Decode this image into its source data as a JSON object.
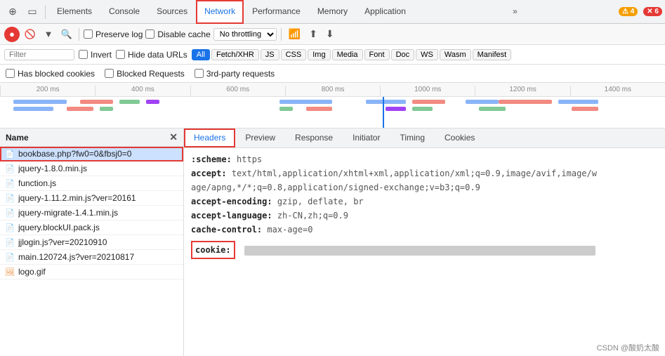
{
  "devtools": {
    "tabs": [
      {
        "id": "elements",
        "label": "Elements",
        "active": false
      },
      {
        "id": "console",
        "label": "Console",
        "active": false
      },
      {
        "id": "sources",
        "label": "Sources",
        "active": false
      },
      {
        "id": "network",
        "label": "Network",
        "active": true
      },
      {
        "id": "performance",
        "label": "Performance",
        "active": false
      },
      {
        "id": "memory",
        "label": "Memory",
        "active": false
      },
      {
        "id": "application",
        "label": "Application",
        "active": false
      },
      {
        "id": "more",
        "label": "»",
        "active": false
      }
    ],
    "badges": {
      "warn_count": "4",
      "err_count": "6"
    },
    "icons": {
      "cursor": "⊹",
      "mobile": "☰",
      "record": "●",
      "clear": "🚫",
      "filter": "▼",
      "search": "🔍",
      "preserve": "Preserve log",
      "disable_cache": "Disable cache",
      "throttling": "No throttling",
      "upload": "⬆",
      "download": "⬇"
    }
  },
  "filter": {
    "placeholder": "Filter",
    "invert_label": "Invert",
    "hide_data_label": "Hide data URLs",
    "types": [
      "All",
      "Fetch/XHR",
      "JS",
      "CSS",
      "Img",
      "Media",
      "Font",
      "Doc",
      "WS",
      "Wasm",
      "Manifest"
    ],
    "active_type": "All"
  },
  "checks": {
    "has_blocked_cookies": "Has blocked cookies",
    "blocked_requests": "Blocked Requests",
    "third_party": "3rd-party requests"
  },
  "timeline": {
    "marks": [
      "200 ms",
      "400 ms",
      "600 ms",
      "800 ms",
      "1000 ms",
      "1200 ms",
      "1400 ms"
    ]
  },
  "file_list": {
    "header": "Name",
    "close_icon": "✕",
    "files": [
      {
        "name": "bookbase.php?fw0=0&fbsj0=0",
        "icon": "📄",
        "type": "html",
        "selected": true
      },
      {
        "name": "jquery-1.8.0.min.js",
        "icon": "📄",
        "type": "js"
      },
      {
        "name": "function.js",
        "icon": "📄",
        "type": "js"
      },
      {
        "name": "jquery-1.11.2.min.js?ver=20161",
        "icon": "📄",
        "type": "js"
      },
      {
        "name": "jquery-migrate-1.4.1.min.js",
        "icon": "📄",
        "type": "js"
      },
      {
        "name": "jquery.blockUI.pack.js",
        "icon": "📄",
        "type": "js"
      },
      {
        "name": "jjlogin.js?ver=20210910",
        "icon": "📄",
        "type": "js"
      },
      {
        "name": "main.120724.js?ver=20210817",
        "icon": "📄",
        "type": "js"
      },
      {
        "name": "logo.gif",
        "icon": "🖼",
        "type": "img"
      }
    ]
  },
  "detail_tabs": [
    {
      "id": "headers",
      "label": "Headers",
      "active": true
    },
    {
      "id": "preview",
      "label": "Preview"
    },
    {
      "id": "response",
      "label": "Response"
    },
    {
      "id": "initiator",
      "label": "Initiator"
    },
    {
      "id": "timing",
      "label": "Timing"
    },
    {
      "id": "cookies",
      "label": "Cookies"
    }
  ],
  "headers": {
    "scheme_label": ":scheme:",
    "scheme_val": "https",
    "accept_key": "accept:",
    "accept_val": "text/html,application/xhtml+xml,application/xml;q=0.9,image/avif,image/w",
    "accept_cont": "age/apng,*/*;q=0.8,application/signed-exchange;v=b3;q=0.9",
    "accept_encoding_key": "accept-encoding:",
    "accept_encoding_val": "gzip, deflate, br",
    "accept_language_key": "accept-language:",
    "accept_language_val": "zh-CN,zh;q=0.9",
    "cache_control_key": "cache-control:",
    "cache_control_val": "max-age=0",
    "cookie_key": "cookie:"
  },
  "watermark": "CSDN @酸奶太酸"
}
